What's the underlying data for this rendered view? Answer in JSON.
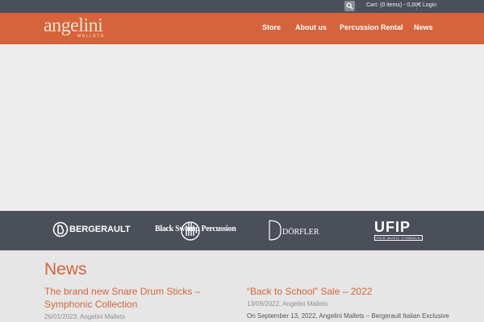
{
  "topbar": {
    "cart": "Cart: (0 items) - 0,00€",
    "login": "Login",
    "search_icon": "search-icon"
  },
  "logo": {
    "main": "angelini",
    "sub": "MALLETS"
  },
  "nav": {
    "items": [
      "Store",
      "About us",
      "Percussion Rental",
      "News"
    ]
  },
  "brands": [
    "BERGERAULT",
    "Black Swamp Percussion",
    "DÖRFLER",
    "UFIP"
  ],
  "brands_sub": {
    "ufip": "FAIR MUSIC CYMBALS"
  },
  "news": {
    "heading": "News",
    "posts": [
      {
        "title": "The brand new Snare Drum Sticks – Symphonic Collection",
        "meta": "26/01/2023, Angelini Mallets",
        "excerpt": ""
      },
      {
        "title": "“Back to School” Sale – 2022",
        "meta": "13/09/2022, Angelini Mallets",
        "excerpt": "On September 13, 2022, Angelini Mallets – Bergerault Italian Exclusive"
      }
    ]
  },
  "colors": {
    "accent": "#d6643a",
    "dark": "#4b4f5a",
    "light": "#e6e6e6"
  }
}
